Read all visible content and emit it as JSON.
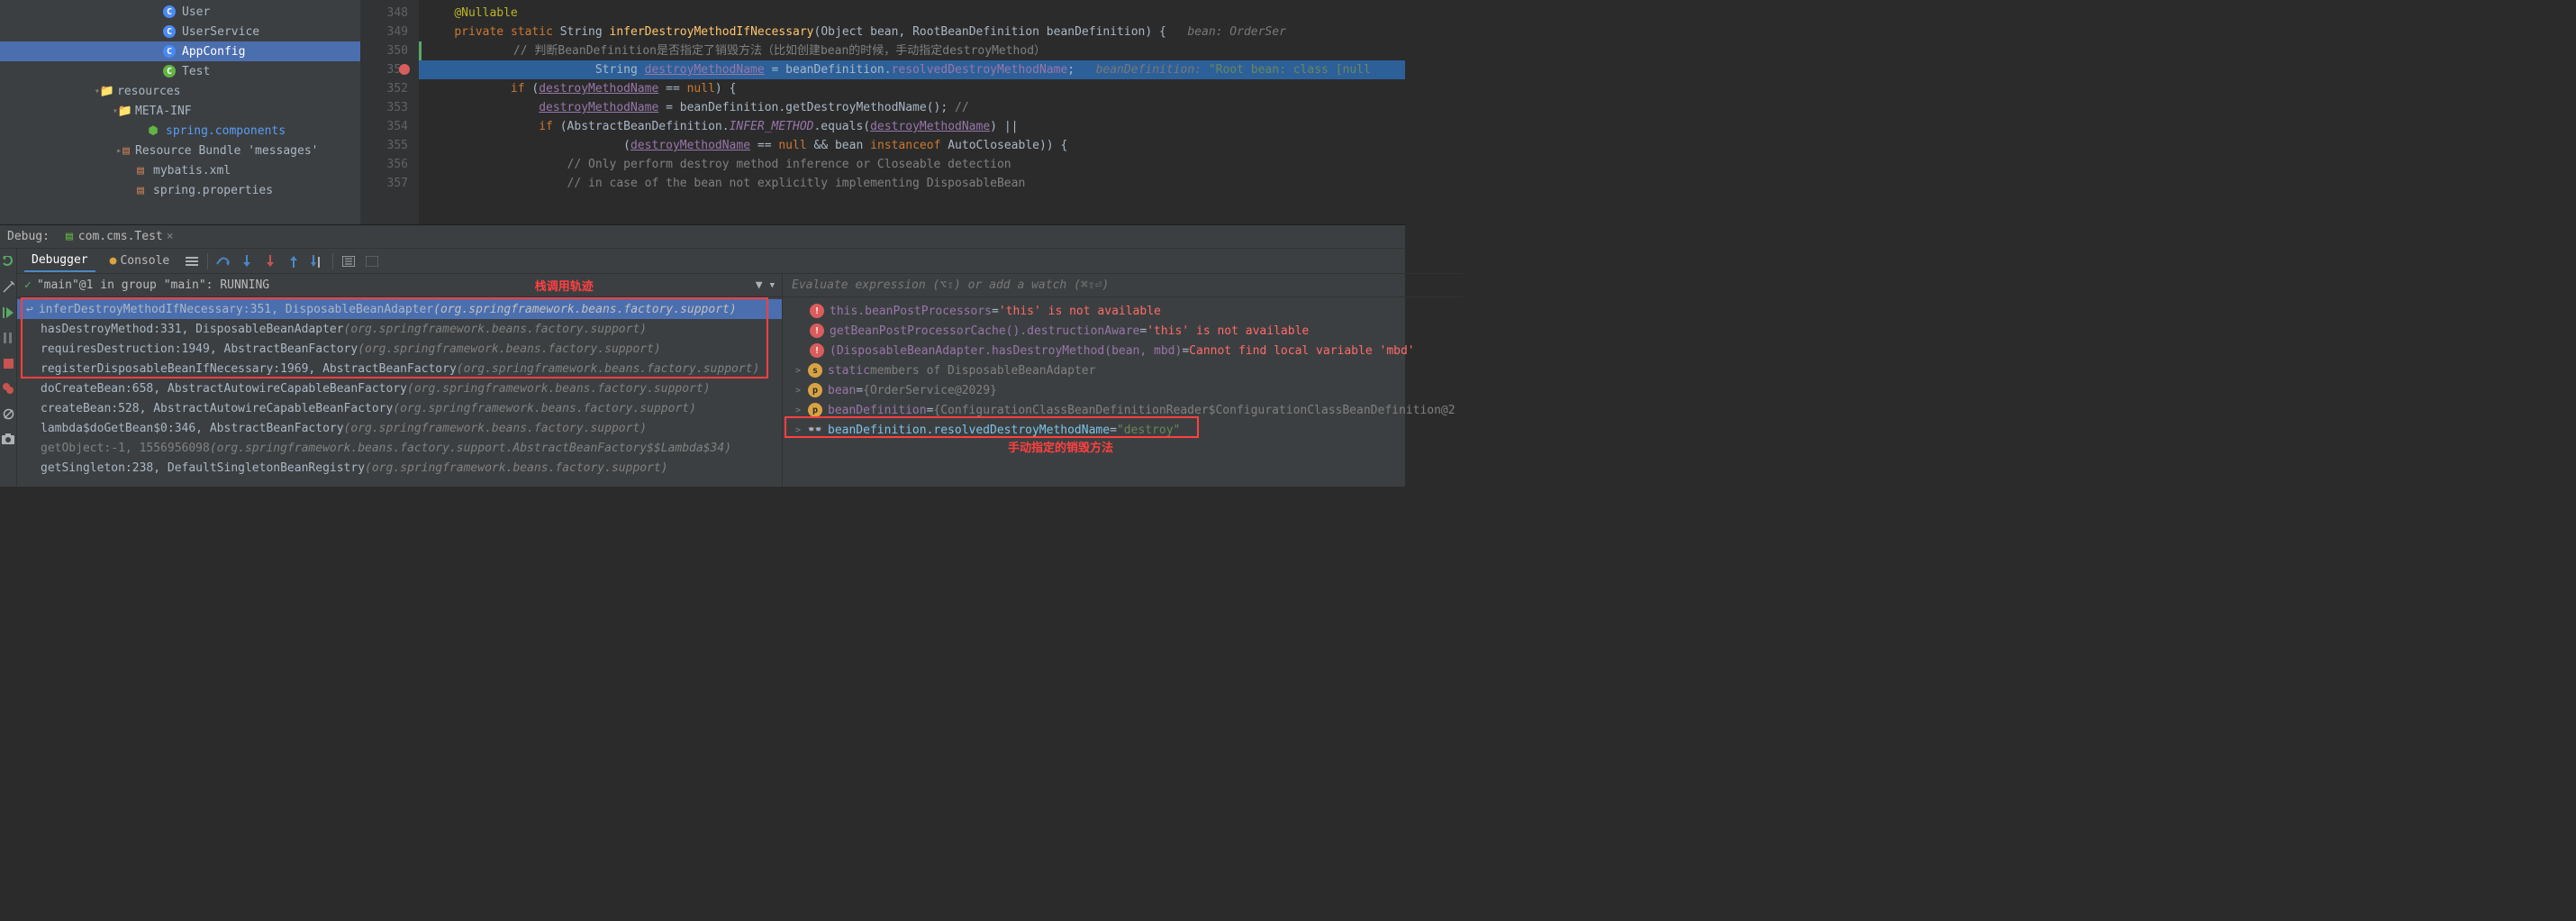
{
  "tree": {
    "items": [
      {
        "indent": 180,
        "icon": "class",
        "label": "User"
      },
      {
        "indent": 180,
        "icon": "class",
        "label": "UserService"
      },
      {
        "indent": 180,
        "icon": "class",
        "label": "AppConfig",
        "selected": true
      },
      {
        "indent": 180,
        "icon": "class-green",
        "label": "Test"
      },
      {
        "indent": 108,
        "icon": "expand-down",
        "folder": true,
        "label": "resources"
      },
      {
        "indent": 128,
        "icon": "expand-down",
        "folder": true,
        "label": "META-INF"
      },
      {
        "indent": 162,
        "icon": "file-s",
        "label": "spring.components",
        "blue": true
      },
      {
        "indent": 128,
        "icon": "expand-right",
        "bundle": true,
        "label": "Resource Bundle 'messages'"
      },
      {
        "indent": 148,
        "icon": "file-x",
        "label": "mybatis.xml"
      },
      {
        "indent": 148,
        "icon": "file-p",
        "label": "spring.properties"
      }
    ]
  },
  "editor": {
    "lines": [
      {
        "num": "348",
        "tokens": [
          {
            "t": "annot",
            "v": "@Nullable",
            "pad": 1
          }
        ]
      },
      {
        "num": "349",
        "tokens": [
          {
            "t": "kw",
            "v": "private ",
            "pad": 1
          },
          {
            "t": "kw",
            "v": "static "
          },
          {
            "t": "cls",
            "v": "String "
          },
          {
            "t": "method",
            "v": "inferDestroyMethodIfNecessary"
          },
          {
            "t": "",
            "v": "(Object bean, RootBeanDefinition beanDefinition) {   "
          },
          {
            "t": "inline-hint",
            "v": "bean: OrderSer"
          }
        ]
      },
      {
        "num": "350",
        "gutter_green": true,
        "tokens": [
          {
            "t": "comment",
            "v": "// 判断BeanDefinition是否指定了销毁方法（比如创建bean的时候，手动指定destroyMethod）",
            "pad": 3
          }
        ]
      },
      {
        "num": "351",
        "breakpoint": true,
        "highlighted": true,
        "tokens": [
          {
            "t": "",
            "v": "String ",
            "pad": 6
          },
          {
            "t": "field",
            "v": "destroyMethodName",
            "u": true
          },
          {
            "t": "",
            "v": " = beanDefinition."
          },
          {
            "t": "field",
            "v": "resolvedDestroyMethodName"
          },
          {
            "t": "",
            "v": ";   "
          },
          {
            "t": "inline-hint",
            "v": "beanDefinition: "
          },
          {
            "t": "str",
            "v": "\"Root bean: class [null"
          }
        ]
      },
      {
        "num": "352",
        "tokens": [
          {
            "t": "kw",
            "v": "if ",
            "pad": 3
          },
          {
            "t": "",
            "v": "("
          },
          {
            "t": "field",
            "v": "destroyMethodName",
            "u": true
          },
          {
            "t": "",
            "v": " == "
          },
          {
            "t": "kw",
            "v": "null"
          },
          {
            "t": "",
            "v": ") {"
          }
        ]
      },
      {
        "num": "353",
        "tokens": [
          {
            "t": "field",
            "v": "destroyMethodName",
            "pad": 4,
            "u": true
          },
          {
            "t": "",
            "v": " = beanDefinition.getDestroyMethodName(); "
          },
          {
            "t": "comment",
            "v": "//"
          }
        ]
      },
      {
        "num": "354",
        "tokens": [
          {
            "t": "kw",
            "v": "if ",
            "pad": 4
          },
          {
            "t": "",
            "v": "(AbstractBeanDefinition."
          },
          {
            "t": "field",
            "v": "INFER_METHOD",
            "i": true
          },
          {
            "t": "",
            "v": ".equals("
          },
          {
            "t": "field",
            "v": "destroyMethodName",
            "u": true
          },
          {
            "t": "",
            "v": ") ||"
          }
        ]
      },
      {
        "num": "355",
        "tokens": [
          {
            "t": "",
            "v": "(",
            "pad": 7
          },
          {
            "t": "field",
            "v": "destroyMethodName",
            "u": true
          },
          {
            "t": "",
            "v": " == "
          },
          {
            "t": "kw",
            "v": "null"
          },
          {
            "t": "",
            "v": " && bean "
          },
          {
            "t": "kw",
            "v": "instanceof"
          },
          {
            "t": "",
            "v": " AutoCloseable)) {"
          }
        ]
      },
      {
        "num": "356",
        "tokens": [
          {
            "t": "comment",
            "v": "// Only perform destroy method inference or Closeable detection",
            "pad": 5
          }
        ]
      },
      {
        "num": "357",
        "tokens": [
          {
            "t": "comment",
            "v": "// in case of the bean not explicitly implementing DisposableBean",
            "pad": 5
          }
        ]
      }
    ]
  },
  "debug": {
    "label": "Debug:",
    "tab": "com.cms.Test",
    "toolbar_tabs": {
      "debugger": "Debugger",
      "console": "Console"
    },
    "frames_thread": "\"main\"@1 in group \"main\": RUNNING",
    "annotation_stack": "栈调用轨迹",
    "frames": [
      {
        "method": "inferDestroyMethodIfNecessary:351, DisposableBeanAdapter",
        "pkg": "(org.springframework.beans.factory.support)",
        "selected": true,
        "return_icon": true
      },
      {
        "method": "hasDestroyMethod:331, DisposableBeanAdapter",
        "pkg": "(org.springframework.beans.factory.support)"
      },
      {
        "method": "requiresDestruction:1949, AbstractBeanFactory",
        "pkg": "(org.springframework.beans.factory.support)"
      },
      {
        "method": "registerDisposableBeanIfNecessary:1969, AbstractBeanFactory",
        "pkg": "(org.springframework.beans.factory.support)"
      },
      {
        "method": "doCreateBean:658, AbstractAutowireCapableBeanFactory",
        "pkg": "(org.springframework.beans.factory.support)"
      },
      {
        "method": "createBean:528, AbstractAutowireCapableBeanFactory",
        "pkg": "(org.springframework.beans.factory.support)"
      },
      {
        "method": "lambda$doGetBean$0:346, AbstractBeanFactory",
        "pkg": "(org.springframework.beans.factory.support)"
      },
      {
        "method": "getObject:-1, 1556956098",
        "pkg": "(org.springframework.beans.factory.support.AbstractBeanFactory$$Lambda$34)",
        "dim": true
      },
      {
        "method": "getSingleton:238, DefaultSingletonBeanRegistry",
        "pkg": "(org.springframework.beans.factory.support)"
      }
    ],
    "vars_placeholder": "Evaluate expression (⌥⇧) or add a watch (⌘⇧⏎)",
    "vars": [
      {
        "icon": "error",
        "name": "this.beanPostProcessors",
        "eq": " = ",
        "val": "'this' is not available",
        "val_class": "red",
        "indent": 30
      },
      {
        "icon": "error",
        "name": "getBeanPostProcessorCache().destructionAware",
        "eq": " = ",
        "val": "'this' is not available",
        "val_class": "red",
        "indent": 30
      },
      {
        "icon": "error",
        "name": "(DisposableBeanAdapter.hasDestroyMethod(bean, mbd)",
        "eq": "  = ",
        "val": "Cannot find local variable 'mbd'",
        "val_class": "red",
        "indent": 30
      },
      {
        "icon": "s",
        "expand": ">",
        "name": "static",
        "name_class": "",
        "eq": " ",
        "val": "members of DisposableBeanAdapter",
        "val_class": "dim",
        "indent": 14
      },
      {
        "icon": "p",
        "expand": ">",
        "name": "bean",
        "eq": " = ",
        "val": "{OrderService@2029}",
        "val_class": "dim",
        "indent": 14
      },
      {
        "icon": "p",
        "expand": ">",
        "name": "beanDefinition",
        "eq": " = ",
        "val": "{ConfigurationClassBeanDefinitionReader$ConfigurationClassBeanDefinition@2",
        "val_class": "dim",
        "indent": 14
      },
      {
        "icon": "glasses",
        "expand": ">",
        "name": "beanDefinition.resolvedDestroyMethodName",
        "name_class": "blue",
        "eq": " = ",
        "val": "\"destroy\"",
        "val_class": "green",
        "indent": 14,
        "boxed": true
      }
    ],
    "annotation_destroy": "手动指定的销毁方法"
  }
}
